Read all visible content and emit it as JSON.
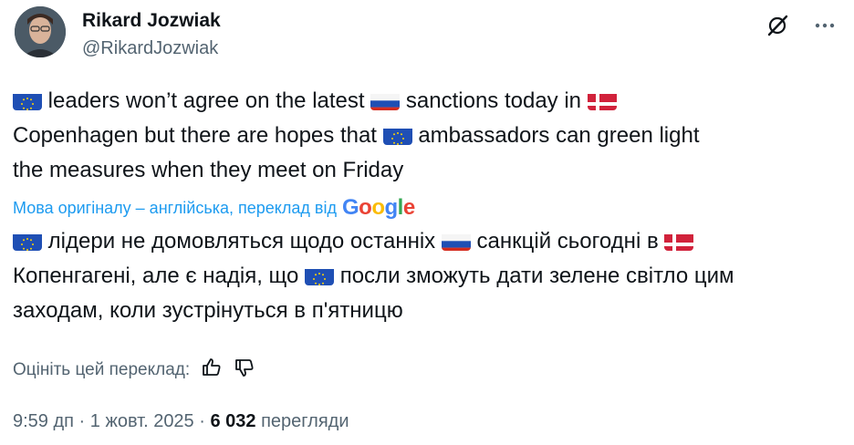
{
  "author": {
    "name": "Rikard Jozwiak",
    "handle": "@RikardJozwiak"
  },
  "icons": [
    "grok-icon",
    "more-options-icon"
  ],
  "tweet": {
    "line1_a": " leaders won’t agree on the latest ",
    "line1_b": " sanctions today in ",
    "line2_a": "Copenhagen but there are hopes that ",
    "line2_b": " ambassadors can green light",
    "line3": "the measures when they meet on Friday"
  },
  "translation": {
    "label": "Мова оригіналу – англійська, переклад від",
    "provider": "Google",
    "line1_a": " лідери не домовляться щодо останніх ",
    "line1_b": " санкцій сьогодні в ",
    "line2_a": "Копенгагені, але є надія, що ",
    "line2_b": " посли зможуть дати зелене світло цим",
    "line3": "заходам, коли зустрінуться в п'ятницю"
  },
  "rate": {
    "label": "Оцініть цей переклад:"
  },
  "meta": {
    "time": "9:59 дп",
    "separator": " · ",
    "date": "1 жовт. 2025",
    "views_count": "6 032",
    "views_label": " перегляди"
  },
  "colors": {
    "link": "#1d9bf0",
    "secondary": "#536471",
    "primary": "#0f1419"
  }
}
